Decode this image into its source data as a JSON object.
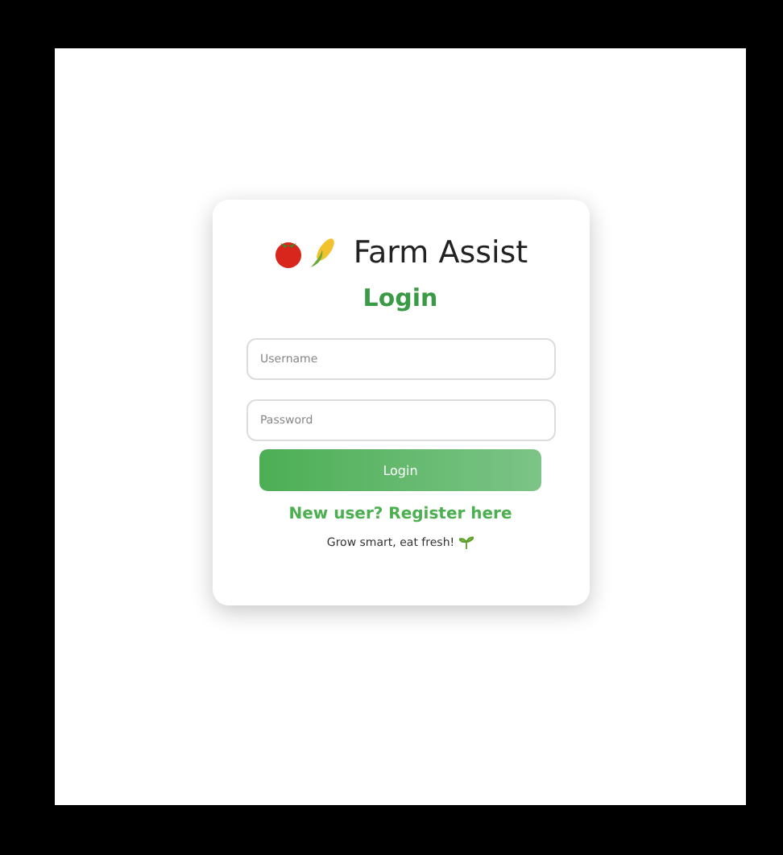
{
  "brand": {
    "title": "Farm Assist"
  },
  "heading": "Login",
  "fields": [
    {
      "placeholder": "Username"
    },
    {
      "placeholder": "Password"
    }
  ],
  "submit": "Login",
  "register_link": "New user? Register here",
  "tagline": "Grow smart, eat fresh!"
}
